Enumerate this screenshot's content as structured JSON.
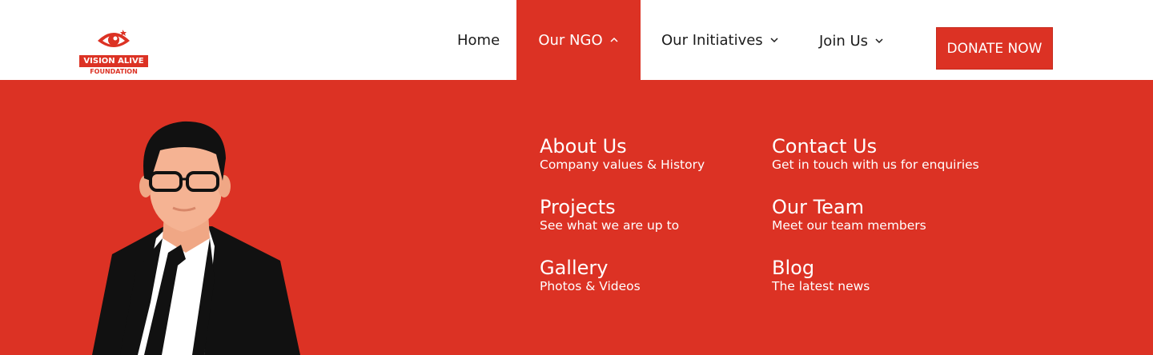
{
  "logo": {
    "name": "VISION ALIVE",
    "sub": "FOUNDATION"
  },
  "nav": {
    "home": "Home",
    "our_ngo": "Our NGO",
    "our_initiatives": "Our Initiatives",
    "join_us": "Join Us",
    "donate": "DONATE NOW"
  },
  "dropdown": {
    "items": [
      {
        "title": "About Us",
        "desc": "Company values & History"
      },
      {
        "title": "Contact Us",
        "desc": "Get in touch with us for enquiries"
      },
      {
        "title": "Projects",
        "desc": "See what we are up to"
      },
      {
        "title": "Our Team",
        "desc": "Meet our team members"
      },
      {
        "title": "Gallery",
        "desc": "Photos & Videos"
      },
      {
        "title": "Blog",
        "desc": "The latest news"
      }
    ]
  },
  "colors": {
    "brand": "#dc3224",
    "text": "#1b1b1b",
    "white": "#ffffff"
  },
  "icons": {
    "chevron_up": "chevron-up-icon",
    "chevron_down": "chevron-down-icon"
  }
}
